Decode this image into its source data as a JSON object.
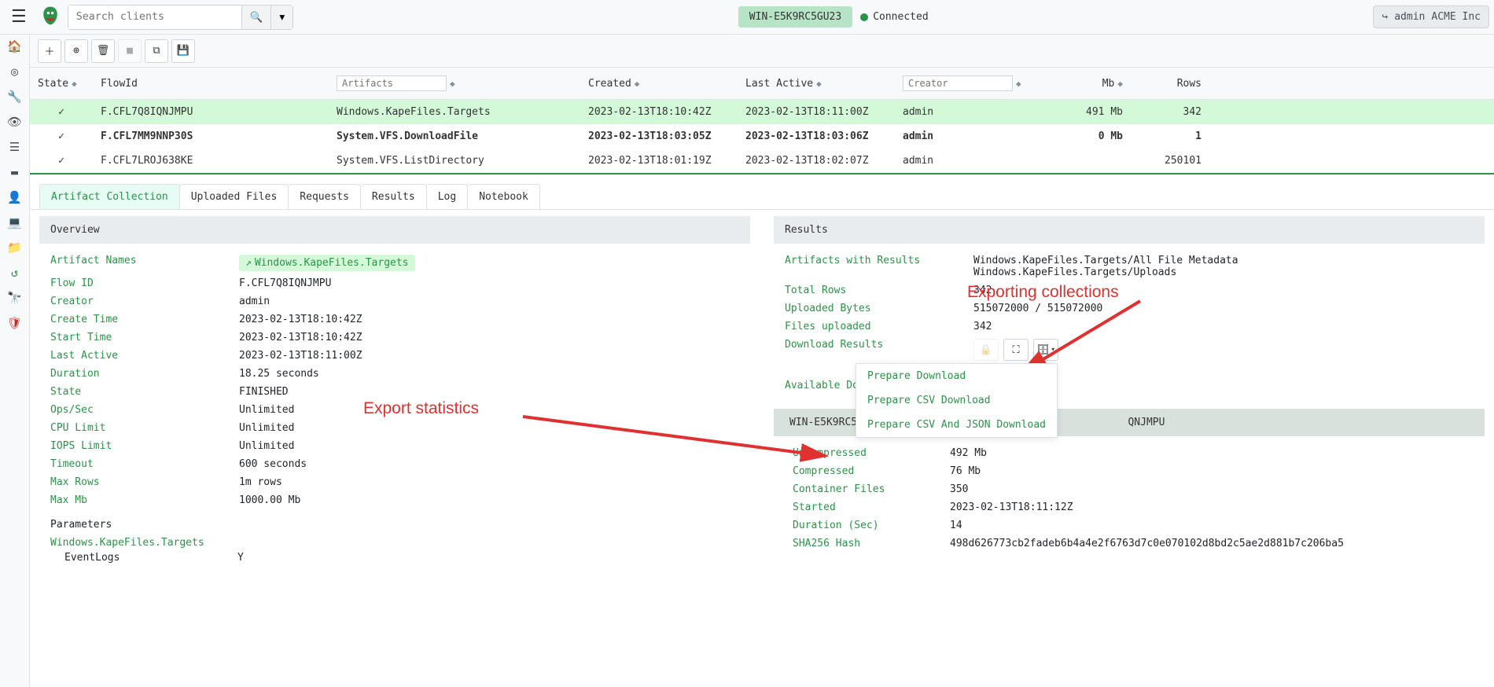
{
  "header": {
    "search_placeholder": "Search clients",
    "client_name": "WIN-E5K9RC5GU23",
    "connection_status": "Connected",
    "user": "admin",
    "org": "ACME Inc"
  },
  "columns": {
    "state": "State",
    "flowid": "FlowId",
    "artifacts_placeholder": "Artifacts",
    "created": "Created",
    "last_active": "Last Active",
    "creator_placeholder": "Creator",
    "mb": "Mb",
    "rows": "Rows"
  },
  "rows": [
    {
      "state": "✓",
      "flowid": "F.CFL7Q8IQNJMPU",
      "artifact": "Windows.KapeFiles.Targets",
      "created": "2023-02-13T18:10:42Z",
      "last_active": "2023-02-13T18:11:00Z",
      "creator": "admin",
      "mb": "491 Mb",
      "rowcount": "342",
      "selected": true,
      "bold": false
    },
    {
      "state": "✓",
      "flowid": "F.CFL7MM9NNP30S",
      "artifact": "System.VFS.DownloadFile",
      "created": "2023-02-13T18:03:05Z",
      "last_active": "2023-02-13T18:03:06Z",
      "creator": "admin",
      "mb": "0 Mb",
      "rowcount": "1",
      "selected": false,
      "bold": true
    },
    {
      "state": "✓",
      "flowid": "F.CFL7LROJ638KE",
      "artifact": "System.VFS.ListDirectory",
      "created": "2023-02-13T18:01:19Z",
      "last_active": "2023-02-13T18:02:07Z",
      "creator": "admin",
      "mb": "",
      "rowcount": "250101",
      "selected": false,
      "bold": false
    }
  ],
  "tabs": [
    "Artifact Collection",
    "Uploaded Files",
    "Requests",
    "Results",
    "Log",
    "Notebook"
  ],
  "overview": {
    "title": "Overview",
    "items": {
      "artifact_names_k": "Artifact Names",
      "artifact_names_v": "Windows.KapeFiles.Targets",
      "flow_id_k": "Flow ID",
      "flow_id_v": "F.CFL7Q8IQNJMPU",
      "creator_k": "Creator",
      "creator_v": "admin",
      "create_time_k": "Create Time",
      "create_time_v": "2023-02-13T18:10:42Z",
      "start_time_k": "Start Time",
      "start_time_v": "2023-02-13T18:10:42Z",
      "last_active_k": "Last Active",
      "last_active_v": "2023-02-13T18:11:00Z",
      "duration_k": "Duration",
      "duration_v": "18.25 seconds",
      "state_k": "State",
      "state_v": "FINISHED",
      "ops_k": "Ops/Sec",
      "ops_v": "Unlimited",
      "cpu_k": "CPU Limit",
      "cpu_v": "Unlimited",
      "iops_k": "IOPS Limit",
      "iops_v": "Unlimited",
      "timeout_k": "Timeout",
      "timeout_v": "600 seconds",
      "maxrows_k": "Max Rows",
      "maxrows_v": "1m rows",
      "maxmb_k": "Max Mb",
      "maxmb_v": "1000.00 Mb"
    },
    "parameters_title": "Parameters",
    "param_artifact": "Windows.KapeFiles.Targets",
    "param_eventlogs_k": "EventLogs",
    "param_eventlogs_v": "Y"
  },
  "results": {
    "title": "Results",
    "artifacts_k": "Artifacts with Results",
    "artifacts_v1": "Windows.KapeFiles.Targets/All File Metadata",
    "artifacts_v2": "Windows.KapeFiles.Targets/Uploads",
    "total_rows_k": "Total Rows",
    "total_rows_v": "342",
    "uploaded_bytes_k": "Uploaded Bytes",
    "uploaded_bytes_v": "515072000 / 515072000",
    "files_uploaded_k": "Files uploaded",
    "files_uploaded_v": "342",
    "download_results_k": "Download Results",
    "available_downloads_k": "Available Downloads",
    "dropdown": {
      "prepare_download": "Prepare Download",
      "prepare_csv": "Prepare CSV Download",
      "prepare_csv_json": "Prepare CSV And JSON Download"
    },
    "download_name": "WIN-E5K9RC5GU23-C.0366aba72cd57f1e-O123                QNJMPU",
    "stats": {
      "uncompressed_k": "Uncompressed",
      "uncompressed_v": "492 Mb",
      "compressed_k": "Compressed",
      "compressed_v": "76 Mb",
      "container_k": "Container Files",
      "container_v": "350",
      "started_k": "Started",
      "started_v": "2023-02-13T18:11:12Z",
      "duration_k": "Duration (Sec)",
      "duration_v": "14",
      "sha_k": "SHA256 Hash",
      "sha_v": "498d626773cb2fadeb6b4a4e2f6763d7c0e070102d8bd2c5ae2d881b7c206ba5"
    }
  },
  "annotations": {
    "export_collections": "Exporting collections",
    "export_stats": "Export statistics"
  }
}
